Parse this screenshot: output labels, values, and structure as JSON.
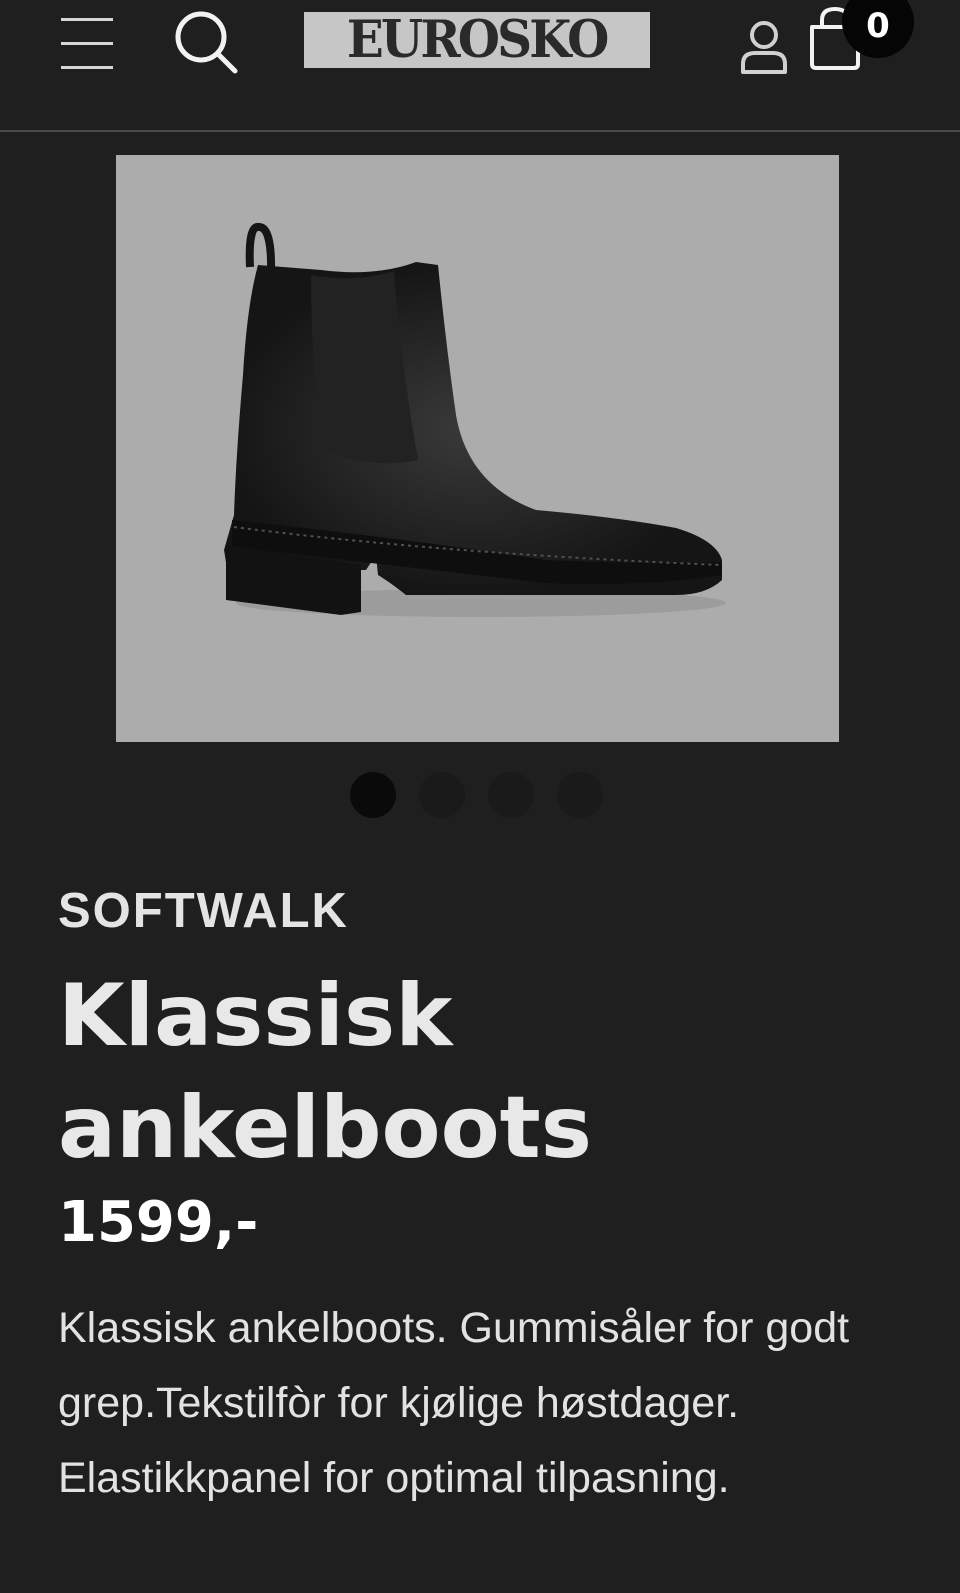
{
  "header": {
    "logo_text": "EUROSKO",
    "cart_count": "0",
    "menu_icon": "hamburger-menu-icon",
    "search_icon": "search-icon",
    "account_icon": "user-icon",
    "cart_icon": "shopping-bag-icon"
  },
  "gallery": {
    "image_alt": "Klassisk ankelboots",
    "slide_count": 4,
    "active_slide": 1
  },
  "product": {
    "brand": "SOFTWALK",
    "title": "Klassisk ankelboots",
    "price": "1599,-",
    "description": "Klassisk ankelboots. Gummisåler for godt grep.Tekstilfòr for kjølige høstdager. Elastikkpanel for optimal tilpasning."
  },
  "colors": {
    "background": "#1f1f20",
    "image_background": "#acacac",
    "text": "#e8e8e8",
    "badge": "#050505"
  }
}
